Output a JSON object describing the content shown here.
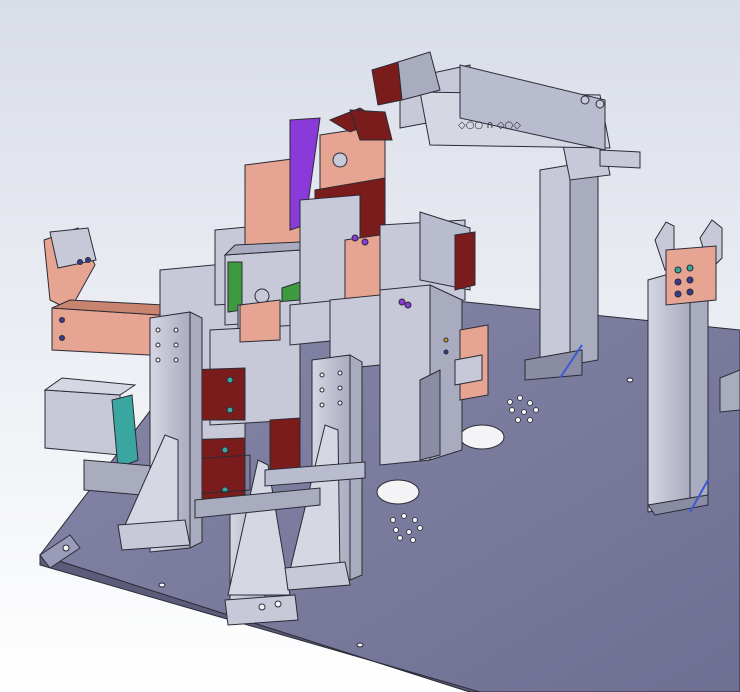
{
  "scene": {
    "kind": "cad-render",
    "background_top": "#d9dde8",
    "background_bottom": "#ffffff",
    "colors": {
      "base_plate": "#7a7a9c",
      "base_plate_edge": "#5c5c7a",
      "steel_light": "#c7c9d8",
      "steel_mid": "#a9abbf",
      "steel_dark": "#8a8ca3",
      "copper": "#e6a492",
      "copper_dark": "#c98470",
      "dark_red": "#7a1c1c",
      "green": "#3f9a3f",
      "teal": "#3aa6a0",
      "purple": "#8a3ad8",
      "hole": "#f4f4f6",
      "line": "#2b2b36"
    }
  }
}
